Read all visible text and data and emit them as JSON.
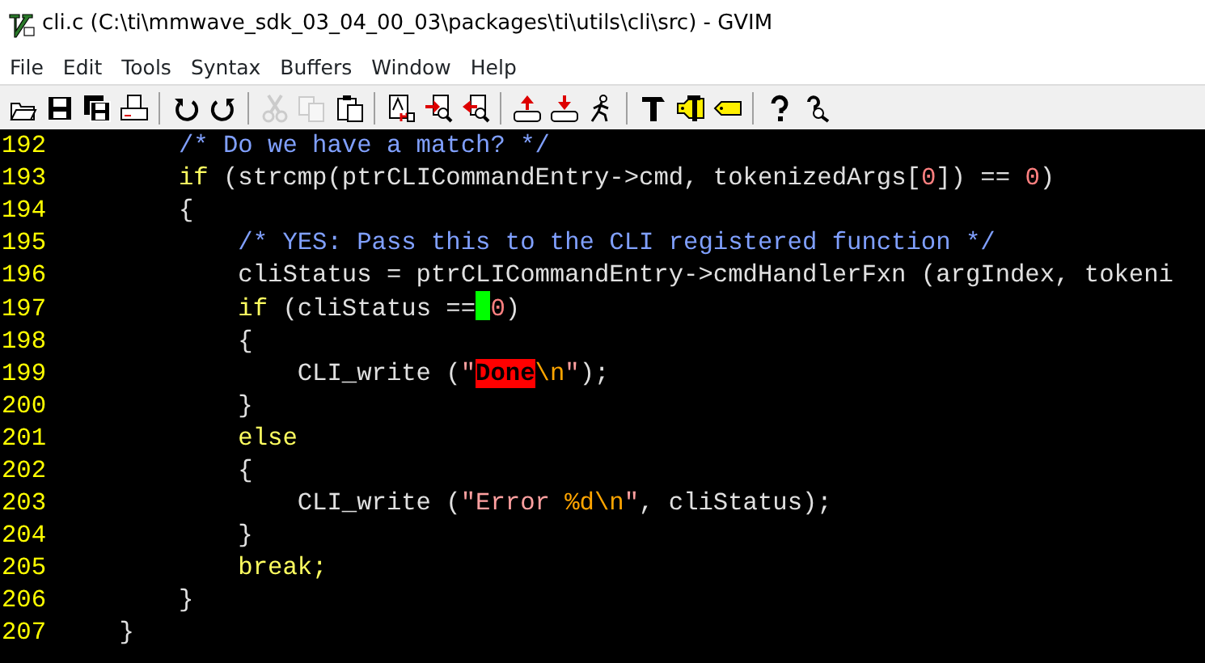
{
  "window": {
    "title": "cli.c (C:\\ti\\mmwave_sdk_03_04_00_03\\packages\\ti\\utils\\cli\\src) - GVIM"
  },
  "menu": [
    "File",
    "Edit",
    "Tools",
    "Syntax",
    "Buffers",
    "Window",
    "Help"
  ],
  "toolbar": [
    {
      "kind": "open",
      "disabled": false
    },
    {
      "kind": "save",
      "disabled": false
    },
    {
      "kind": "save-all",
      "disabled": false
    },
    {
      "kind": "print",
      "disabled": false
    },
    {
      "kind": "separator"
    },
    {
      "kind": "undo",
      "disabled": false
    },
    {
      "kind": "redo",
      "disabled": false
    },
    {
      "kind": "separator"
    },
    {
      "kind": "cut",
      "disabled": true
    },
    {
      "kind": "copy",
      "disabled": true
    },
    {
      "kind": "paste",
      "disabled": false
    },
    {
      "kind": "separator"
    },
    {
      "kind": "replace",
      "disabled": false
    },
    {
      "kind": "find-next",
      "disabled": false
    },
    {
      "kind": "find-prev",
      "disabled": false
    },
    {
      "kind": "separator"
    },
    {
      "kind": "load-session",
      "disabled": false
    },
    {
      "kind": "save-session",
      "disabled": false
    },
    {
      "kind": "run-script",
      "disabled": false
    },
    {
      "kind": "separator"
    },
    {
      "kind": "make",
      "disabled": false
    },
    {
      "kind": "build-tags",
      "disabled": false
    },
    {
      "kind": "tag-jump",
      "disabled": false
    },
    {
      "kind": "separator"
    },
    {
      "kind": "help",
      "disabled": false
    },
    {
      "kind": "find-help",
      "disabled": false
    }
  ],
  "editor": {
    "lines": [
      {
        "number": "192",
        "tokens": [
          {
            "kind": "comment",
            "text": "        /* Do we have a match? */"
          }
        ]
      },
      {
        "number": "193",
        "tokens": [
          {
            "kind": "keyword",
            "text": "        if"
          },
          {
            "kind": "plain",
            "text": " (strcmp(ptrCLICommandEntry->cmd, tokenizedArgs["
          },
          {
            "kind": "number",
            "text": "0"
          },
          {
            "kind": "plain",
            "text": "]) == "
          },
          {
            "kind": "number",
            "text": "0"
          },
          {
            "kind": "plain",
            "text": ")"
          }
        ]
      },
      {
        "number": "194",
        "tokens": [
          {
            "kind": "plain",
            "text": "        {"
          }
        ]
      },
      {
        "number": "195",
        "tokens": [
          {
            "kind": "comment",
            "text": "            /* YES: Pass this to the CLI registered function */"
          }
        ]
      },
      {
        "number": "196",
        "tokens": [
          {
            "kind": "plain",
            "text": "            cliStatus = ptrCLICommandEntry->cmdHandlerFxn (argIndex, tokeni"
          }
        ]
      },
      {
        "number": "197",
        "tokens": [
          {
            "kind": "keyword",
            "text": "            if"
          },
          {
            "kind": "plain",
            "text": " (cliStatus =="
          },
          {
            "kind": "cursor"
          },
          {
            "kind": "number",
            "text": "0"
          },
          {
            "kind": "plain",
            "text": ")"
          }
        ]
      },
      {
        "number": "198",
        "tokens": [
          {
            "kind": "plain",
            "text": "            {"
          }
        ]
      },
      {
        "number": "199",
        "tokens": [
          {
            "kind": "plain",
            "text": "                CLI_write ("
          },
          {
            "kind": "string",
            "text": "\""
          },
          {
            "kind": "error",
            "text": "Done"
          },
          {
            "kind": "special",
            "text": "\\n"
          },
          {
            "kind": "string",
            "text": "\""
          },
          {
            "kind": "plain",
            "text": ");"
          }
        ]
      },
      {
        "number": "200",
        "tokens": [
          {
            "kind": "plain",
            "text": "            }"
          }
        ]
      },
      {
        "number": "201",
        "tokens": [
          {
            "kind": "keyword",
            "text": "            else"
          }
        ]
      },
      {
        "number": "202",
        "tokens": [
          {
            "kind": "plain",
            "text": "            {"
          }
        ]
      },
      {
        "number": "203",
        "tokens": [
          {
            "kind": "plain",
            "text": "                CLI_write ("
          },
          {
            "kind": "string",
            "text": "\"Error "
          },
          {
            "kind": "special",
            "text": "%d\\n"
          },
          {
            "kind": "string",
            "text": "\""
          },
          {
            "kind": "plain",
            "text": ", cliStatus);"
          }
        ]
      },
      {
        "number": "204",
        "tokens": [
          {
            "kind": "plain",
            "text": "            }"
          }
        ]
      },
      {
        "number": "205",
        "tokens": [
          {
            "kind": "keyword",
            "text": "            break;"
          }
        ]
      },
      {
        "number": "206",
        "tokens": [
          {
            "kind": "plain",
            "text": "        }"
          }
        ]
      },
      {
        "number": "207",
        "tokens": [
          {
            "kind": "plain",
            "text": "    }"
          }
        ]
      }
    ]
  }
}
